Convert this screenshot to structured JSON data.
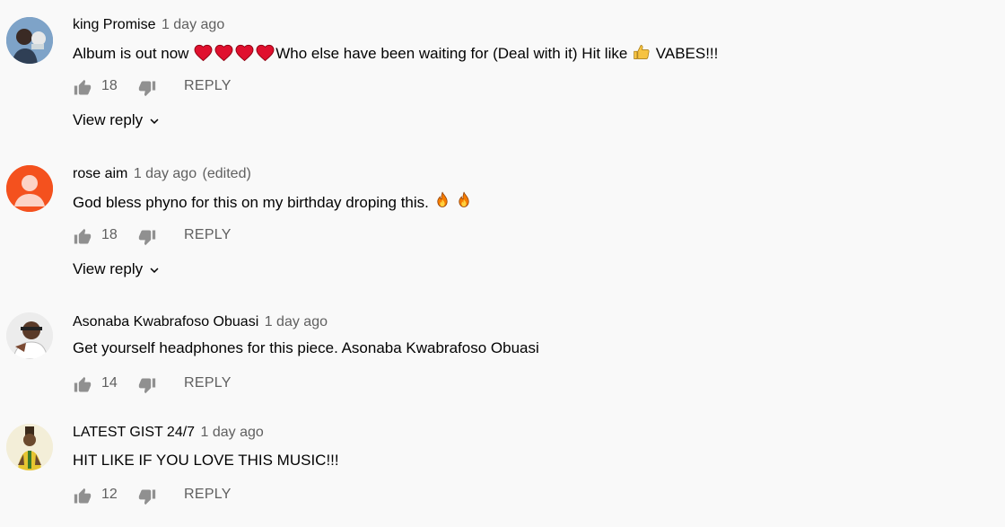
{
  "comments": [
    {
      "author": "king Promise",
      "time": "1 day ago",
      "edited": "",
      "text_before": "Album is out now",
      "text_after": "Who else have been waiting for  (Deal with it) Hit like",
      "text_end": "VABES!!!",
      "likes": "18",
      "reply_label": "REPLY",
      "view_reply_label": "View reply",
      "avatar_icon": "profile-photo"
    },
    {
      "author": "rose aim",
      "time": "1 day ago",
      "edited": "(edited)",
      "text": "God bless phyno for this on my birthday droping this.",
      "likes": "18",
      "reply_label": "REPLY",
      "view_reply_label": "View reply",
      "avatar_color": "#f4511e",
      "avatar_icon": "default-person-icon"
    },
    {
      "author": "Asonaba Kwabrafoso Obuasi",
      "time": "1 day ago",
      "text": "Get yourself headphones for this piece. Asonaba Kwabrafoso Obuasi",
      "likes": "14",
      "reply_label": "REPLY",
      "avatar_icon": "profile-photo"
    },
    {
      "author": "LATEST GIST 24/7",
      "time": "1 day ago",
      "text": "HIT LIKE IF YOU LOVE THIS MUSIC!!!",
      "likes": "12",
      "reply_label": "REPLY",
      "avatar_icon": "profile-photo"
    }
  ],
  "colors": {
    "background": "#f9f9f9",
    "secondary_text": "#606060",
    "heart": "#e0102e",
    "fire": "#f57c00"
  }
}
